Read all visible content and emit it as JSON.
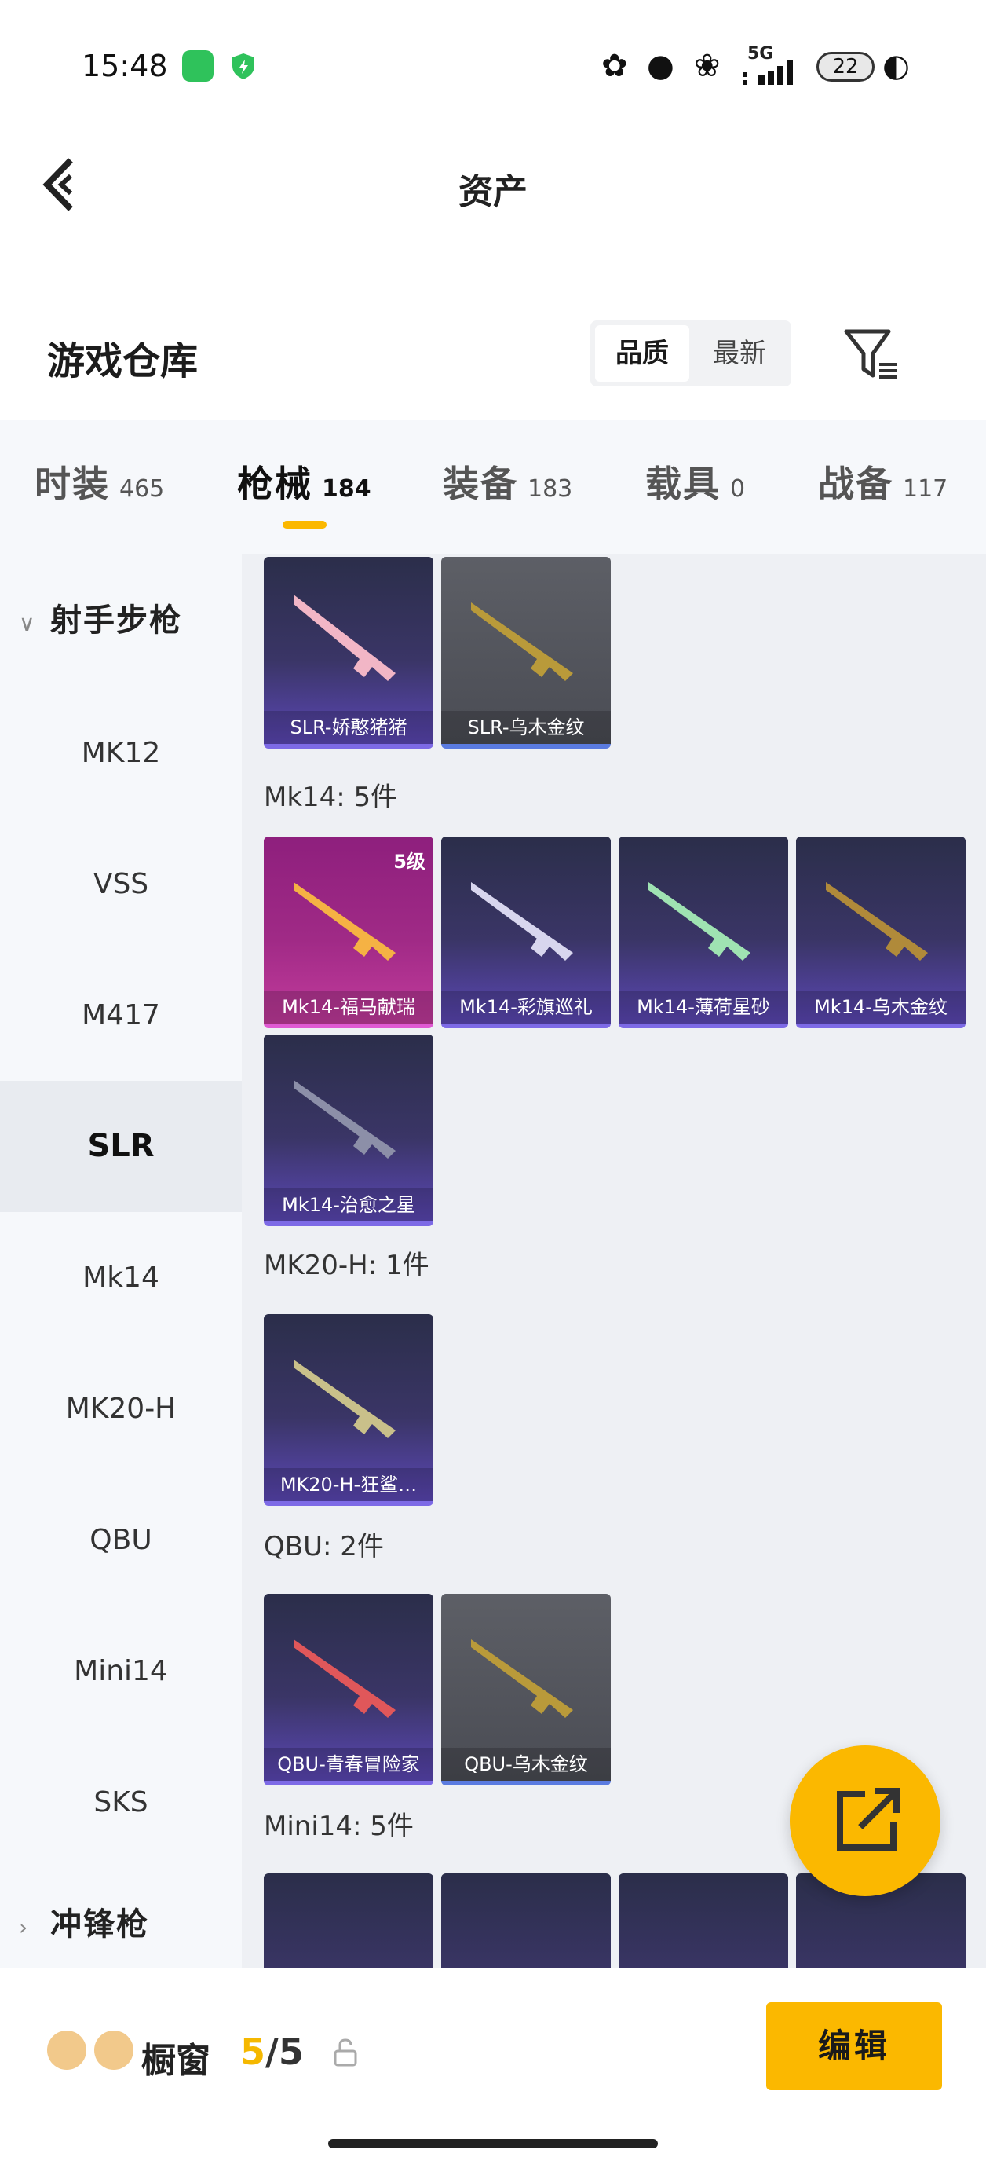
{
  "status_bar": {
    "time": "15:48",
    "network": "5G",
    "battery": "22"
  },
  "header": {
    "title": "资产"
  },
  "warehouse": {
    "title": "游戏仓库",
    "sort_options": [
      "品质",
      "最新"
    ],
    "active_sort": "品质"
  },
  "tabs": [
    {
      "label": "时装",
      "count": "465"
    },
    {
      "label": "枪械",
      "count": "184",
      "active": true
    },
    {
      "label": "装备",
      "count": "183"
    },
    {
      "label": "载具",
      "count": "0"
    },
    {
      "label": "战备",
      "count": "117"
    }
  ],
  "sidebar": {
    "group1": "射手步枪",
    "items": [
      "MK12",
      "VSS",
      "M417",
      "SLR",
      "Mk14",
      "MK20-H",
      "QBU",
      "Mini14",
      "SKS"
    ],
    "active_item": "SLR",
    "group2": "冲锋枪"
  },
  "sections": {
    "slr_cards": [
      "SLR-娇憨猪猪",
      "SLR-乌木金纹"
    ],
    "mk14": {
      "label": "Mk14: 5件",
      "cards": [
        "Mk14-福马献瑞",
        "Mk14-彩旗巡礼",
        "Mk14-薄荷星砂",
        "Mk14-乌木金纹",
        "Mk14-治愈之星"
      ],
      "level_badge": "5级"
    },
    "mk20h": {
      "label": "MK20-H: 1件",
      "cards": [
        "MK20-H-狂鲨…"
      ]
    },
    "qbu": {
      "label": "QBU: 2件",
      "cards": [
        "QBU-青春冒险家",
        "QBU-乌木金纹"
      ]
    },
    "mini14": {
      "label": "Mini14: 5件"
    }
  },
  "bottom_bar": {
    "label": "橱窗",
    "count_current": "5",
    "count_total": "/5",
    "edit_label": "编辑"
  },
  "colors": {
    "accent": "#fbb800",
    "purple_card": "#3a3566",
    "pink_card": "#a02a86",
    "gray_card": "#4a4c54"
  }
}
